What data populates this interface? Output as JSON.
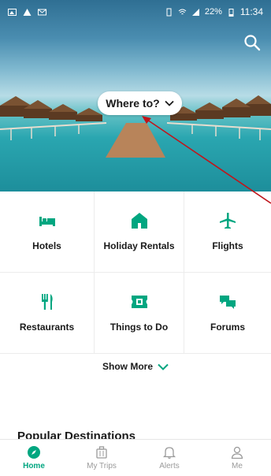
{
  "status_bar": {
    "time": "11:34",
    "battery": "22%"
  },
  "hero": {
    "where_to_label": "Where to?"
  },
  "categories": [
    {
      "label": "Hotels",
      "icon": "bed-icon"
    },
    {
      "label": "Holiday Rentals",
      "icon": "house-icon"
    },
    {
      "label": "Flights",
      "icon": "plane-icon"
    },
    {
      "label": "Restaurants",
      "icon": "fork-knife-icon"
    },
    {
      "label": "Things to Do",
      "icon": "ticket-icon"
    },
    {
      "label": "Forums",
      "icon": "chat-bubbles-icon"
    }
  ],
  "show_more_label": "Show More",
  "popular_heading": "Popular Destinations",
  "bottom_nav": [
    {
      "label": "Home",
      "icon": "compass-icon",
      "active": true
    },
    {
      "label": "My Trips",
      "icon": "suitcase-icon",
      "active": false
    },
    {
      "label": "Alerts",
      "icon": "bell-icon",
      "active": false
    },
    {
      "label": "Me",
      "icon": "person-icon",
      "active": false
    }
  ],
  "colors": {
    "accent": "#00a680",
    "annotation_arrow": "#c0151b"
  }
}
